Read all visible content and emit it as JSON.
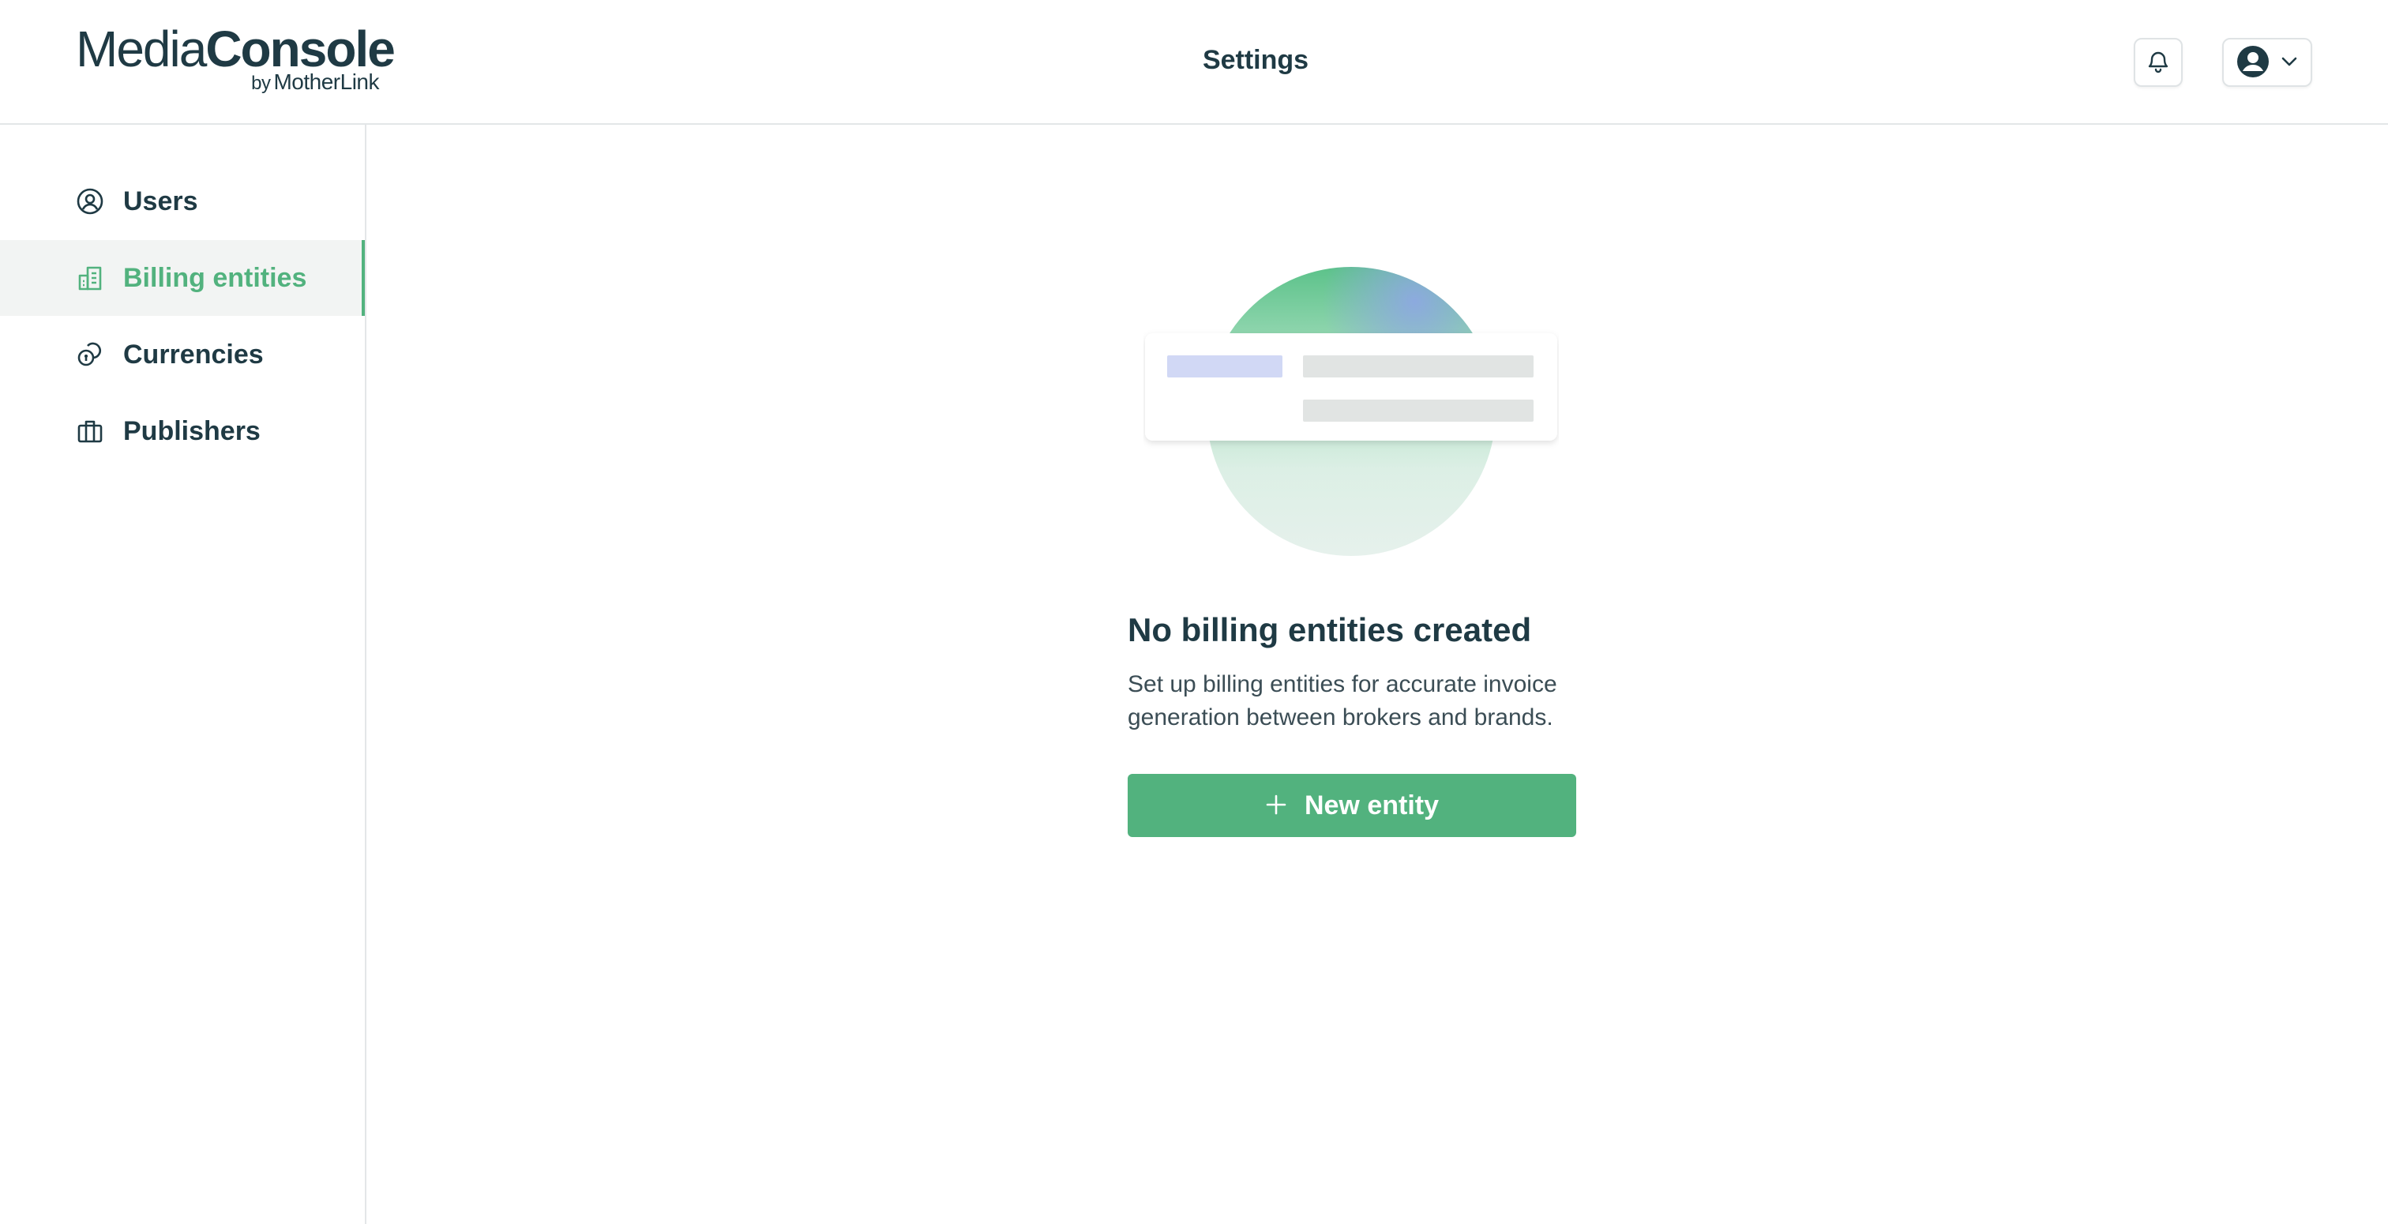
{
  "app": {
    "logo_light": "Media",
    "logo_bold": "Console",
    "logo_by": "by",
    "logo_company": "MotherLink"
  },
  "header": {
    "title": "Settings",
    "notifications_icon": "bell-icon",
    "user_menu_icons": [
      "user-circle-icon",
      "chevron-down-icon"
    ]
  },
  "sidebar": {
    "items": [
      {
        "label": "Users",
        "icon": "user-circle-icon",
        "active": false
      },
      {
        "label": "Billing entities",
        "icon": "building-icon",
        "active": true
      },
      {
        "label": "Currencies",
        "icon": "coins-icon",
        "active": false
      },
      {
        "label": "Publishers",
        "icon": "briefcase-icon",
        "active": false
      }
    ]
  },
  "empty_state": {
    "title": "No billing entities created",
    "description": "Set up billing entities for accurate invoice generation between brokers and brands.",
    "button_label": "New entity",
    "button_icon": "plus-icon"
  },
  "colors": {
    "accent": "#52b27e",
    "text": "#1f3a44",
    "border": "#e3e6e8",
    "active_bg": "#f2f4f3"
  }
}
